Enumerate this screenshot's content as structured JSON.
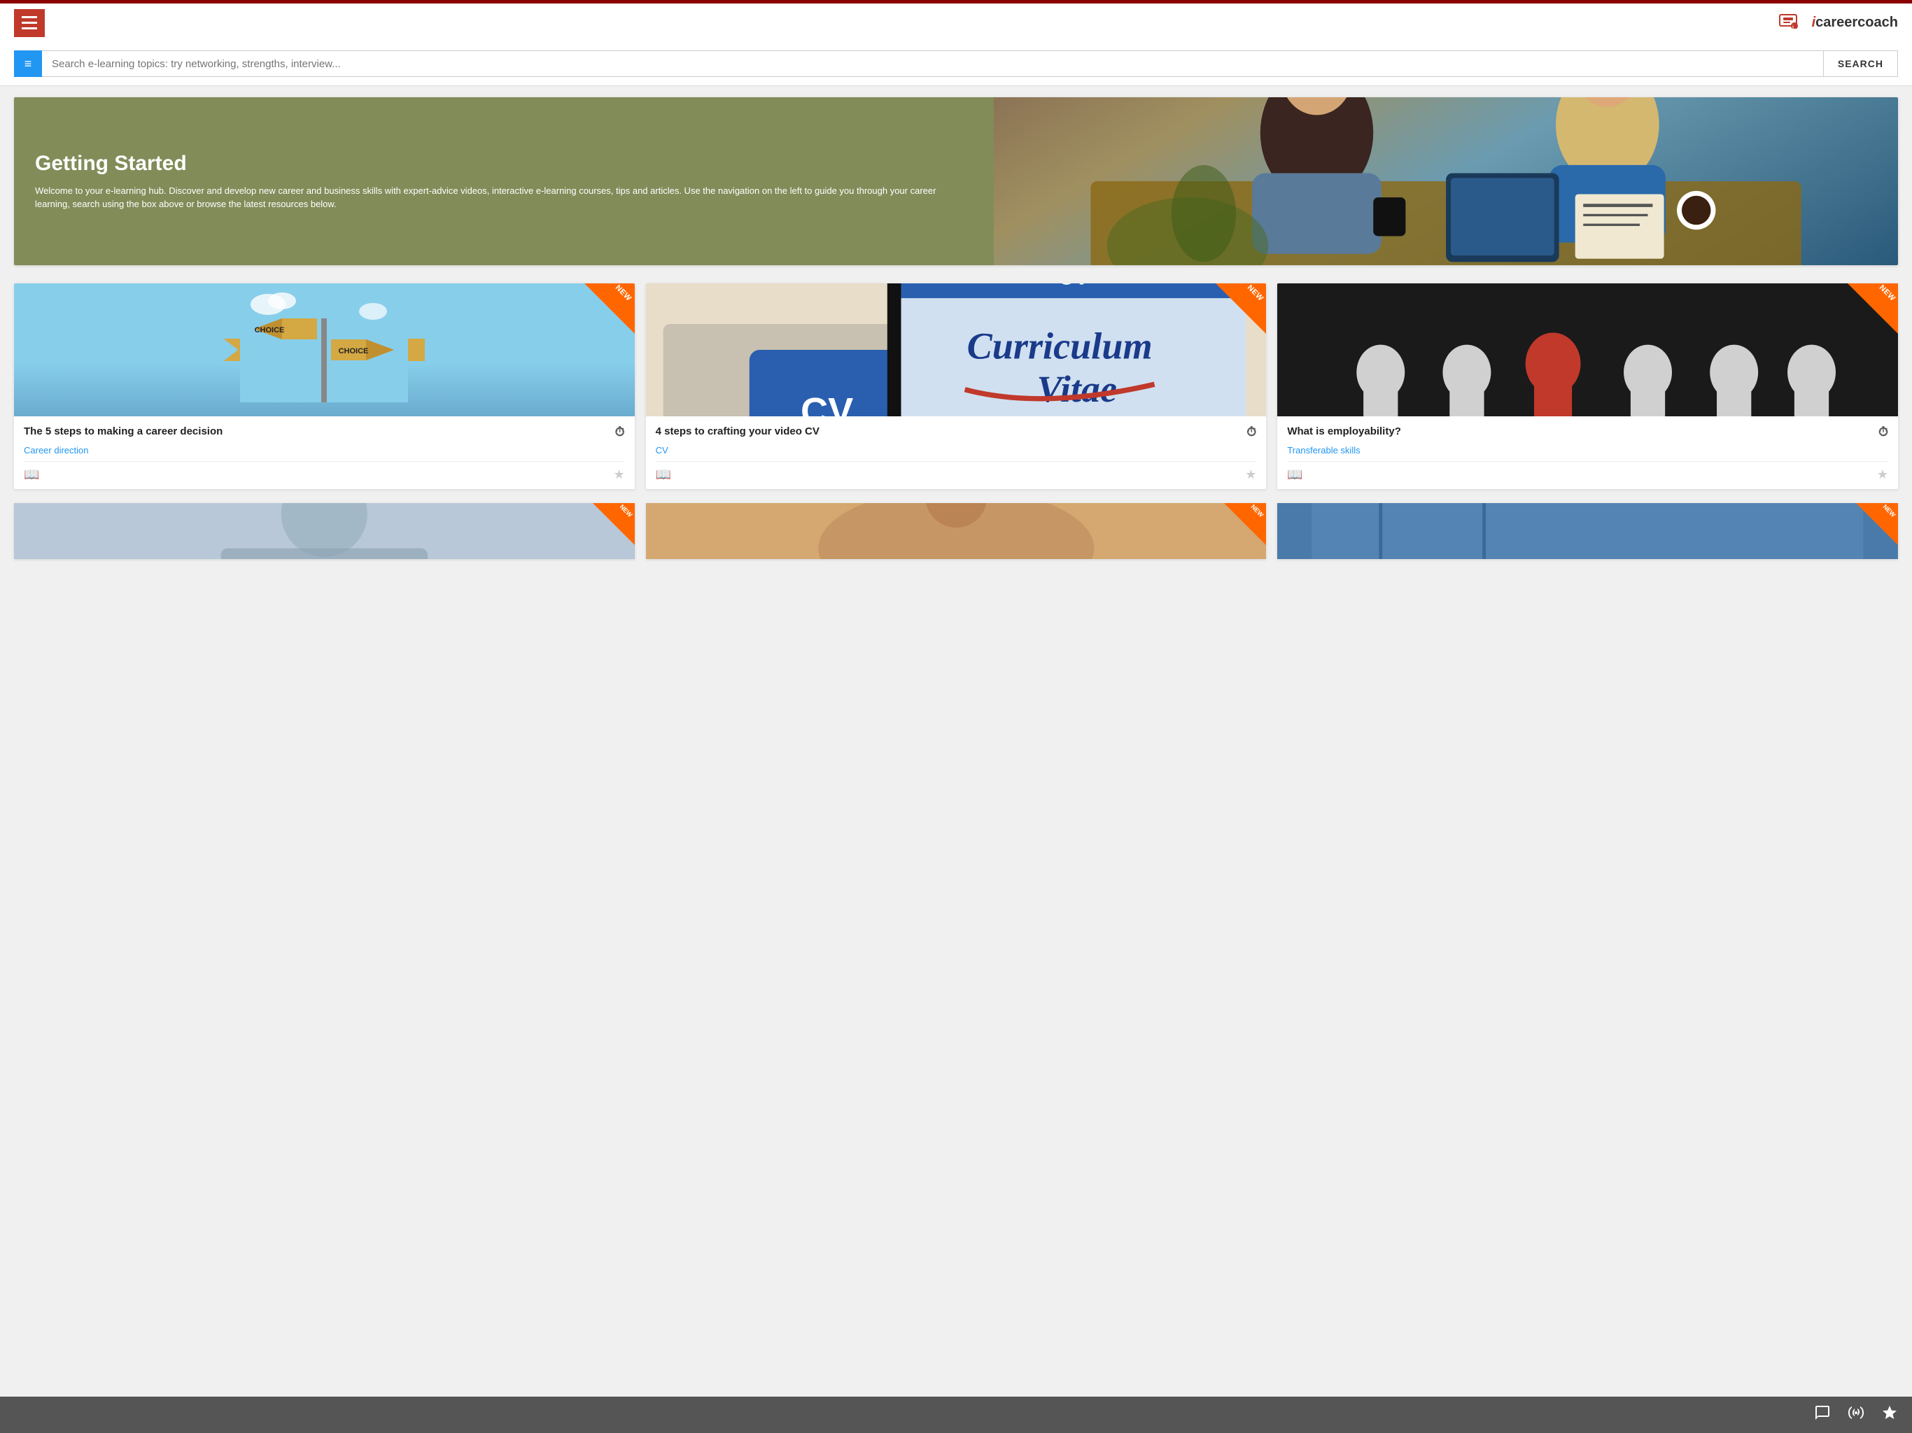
{
  "header": {
    "hamburger_label": "Menu",
    "app_name": "careercoach",
    "app_name_prefix": "i"
  },
  "search": {
    "placeholder": "Search e-learning topics: try networking, strengths, interview...",
    "button_label": "SEARCH",
    "filter_icon": "≡"
  },
  "hero": {
    "title": "Getting Started",
    "description": "Welcome to your e-learning hub. Discover and develop new career and business skills with expert-advice videos, interactive e-learning courses, tips and articles. Use the navigation on the left to guide you through your career learning, search using the box above or browse the latest resources below."
  },
  "cards": [
    {
      "id": "card-1",
      "title": "The 5 steps to making a career decision",
      "category": "Career direction",
      "is_new": true,
      "image_type": "signpost"
    },
    {
      "id": "card-2",
      "title": "4 steps to crafting your video CV",
      "category": "CV",
      "is_new": true,
      "image_type": "cv"
    },
    {
      "id": "card-3",
      "title": "What is employability?",
      "category": "Transferable skills",
      "is_new": true,
      "image_type": "pawns"
    }
  ],
  "bottom_bar": {
    "chat_label": "Chat",
    "broadcast_label": "Broadcast",
    "favorites_label": "Favorites"
  },
  "labels": {
    "new_badge": "NEW",
    "bookmark": "📖",
    "star": "★",
    "timer": "⏱"
  }
}
